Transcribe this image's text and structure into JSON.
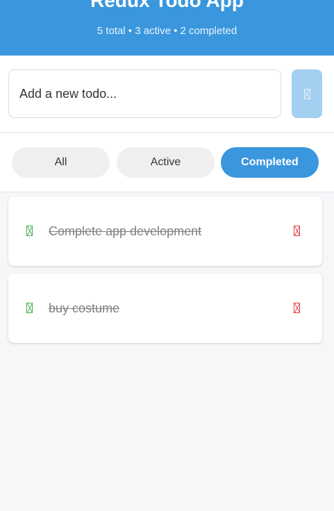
{
  "header": {
    "title": "Redux Todo App",
    "subtitle": "5 total • 3 active • 2 completed"
  },
  "input": {
    "placeholder": "Add a new todo...",
    "value": "",
    "add_icon": "plus-icon"
  },
  "filters": [
    {
      "label": "All",
      "active": false
    },
    {
      "label": "Active",
      "active": false
    },
    {
      "label": "Completed",
      "active": true
    }
  ],
  "todos": [
    {
      "text": "Complete app development",
      "completed": true,
      "check_icon": "check-icon",
      "delete_icon": "trash-icon"
    },
    {
      "text": "buy costume",
      "completed": true,
      "check_icon": "check-icon",
      "delete_icon": "trash-icon"
    }
  ],
  "colors": {
    "accent": "#3a97dd",
    "check": "#4aab52",
    "delete": "#e23c3c",
    "add_button_disabled": "#a3cff0"
  }
}
